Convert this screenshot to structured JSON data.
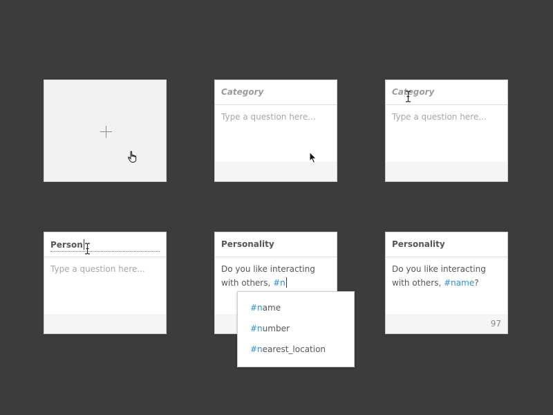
{
  "cards": {
    "add_card": {
      "icon": "plus-icon"
    },
    "empty_card_1": {
      "category_placeholder": "Category",
      "question_placeholder": "Type a question here..."
    },
    "empty_card_2": {
      "category_placeholder": "Category",
      "question_placeholder": "Type a question here..."
    },
    "editing_category_card": {
      "category_value": "Person",
      "question_placeholder": "Type a question here..."
    },
    "typing_card": {
      "category": "Personality",
      "question_text": "Do you like interacting with others, ",
      "question_tag": "#n"
    },
    "completed_card": {
      "category": "Personality",
      "question_text": "Do you like interacting with others, ",
      "question_tag": "#name",
      "question_suffix": "?",
      "char_count": "97"
    }
  },
  "autocomplete": {
    "items": [
      {
        "match": "#n",
        "rest": "ame"
      },
      {
        "match": "#n",
        "rest": "umber"
      },
      {
        "match": "#n",
        "rest": "earest_location"
      }
    ]
  },
  "colors": {
    "background": "#3c3c3c",
    "tag_accent": "#2f8fd0"
  }
}
